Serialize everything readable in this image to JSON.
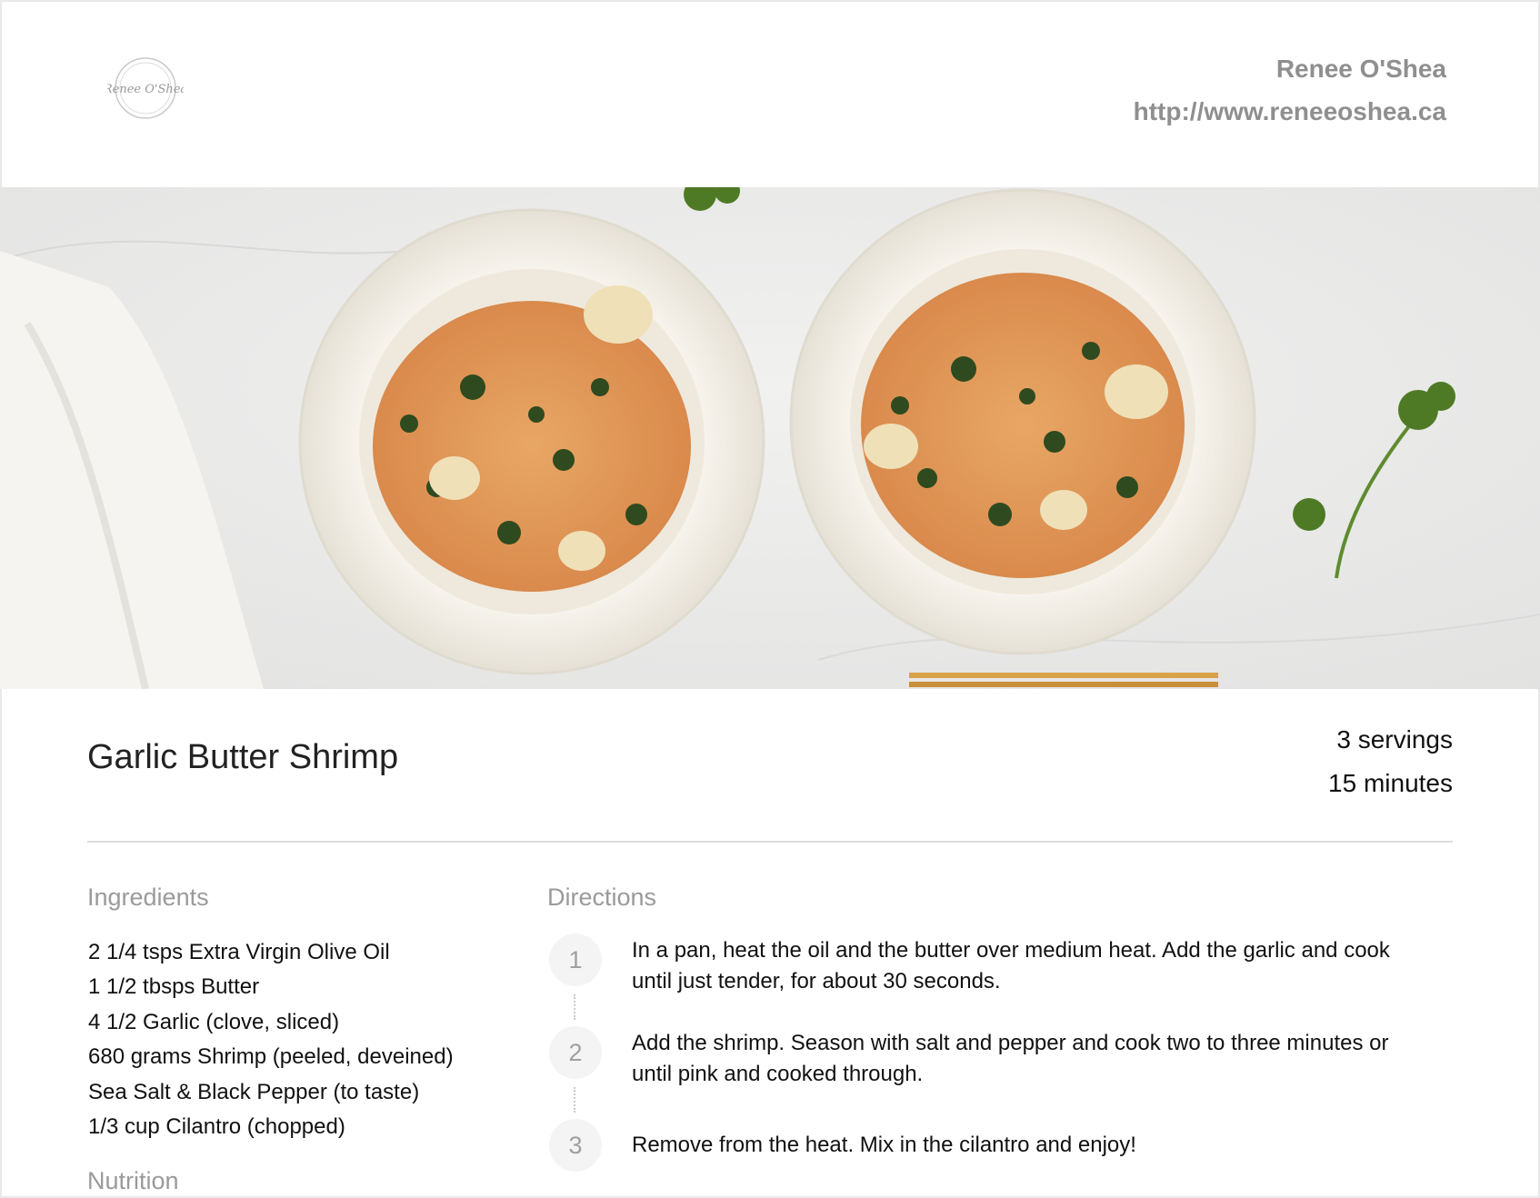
{
  "header": {
    "logo_text": "Renee O'Shea",
    "author_name": "Renee O'Shea",
    "author_url": "http://www.reneeoshea.ca"
  },
  "hero": {
    "image_icon": "shrimp-dish-photo"
  },
  "recipe": {
    "title": "Garlic Butter Shrimp",
    "servings": "3 servings",
    "time": "15 minutes"
  },
  "ingredients": {
    "heading": "Ingredients",
    "items": [
      "2 1/4 tsps Extra Virgin Olive Oil",
      "1 1/2 tbsps Butter",
      "4 1/2 Garlic (clove, sliced)",
      "680 grams Shrimp (peeled, deveined)",
      "Sea Salt & Black Pepper (to taste)",
      "1/3 cup Cilantro (chopped)"
    ]
  },
  "nutrition": {
    "heading": "Nutrition"
  },
  "directions": {
    "heading": "Directions",
    "steps": [
      {
        "number": "1",
        "text": "In a pan, heat the oil and the butter over medium heat. Add the garlic and cook until just tender, for about 30 seconds."
      },
      {
        "number": "2",
        "text": "Add the shrimp. Season with salt and pepper and cook two to three minutes or until pink and cooked through."
      },
      {
        "number": "3",
        "text": "Remove from the heat. Mix in the cilantro and enjoy!"
      }
    ]
  }
}
